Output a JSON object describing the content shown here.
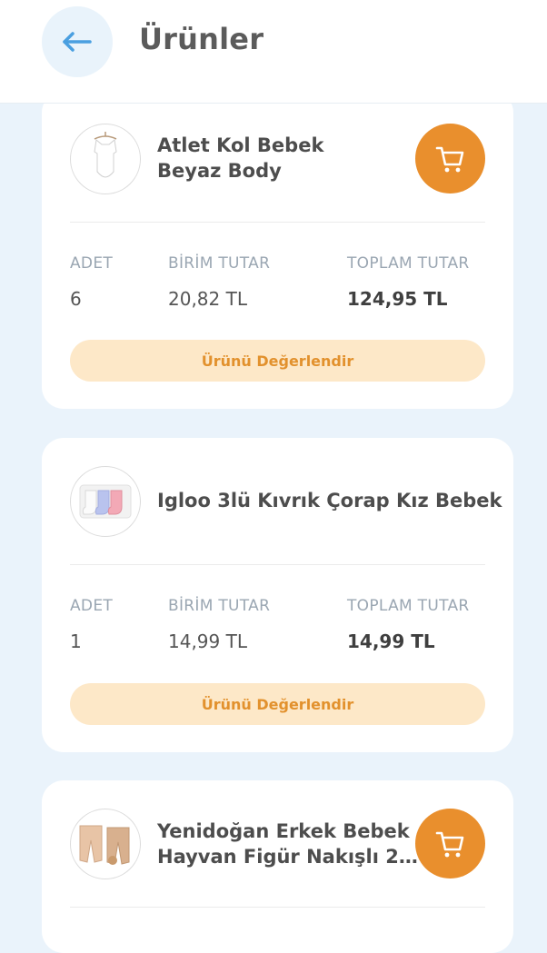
{
  "header": {
    "title": "Ürünler"
  },
  "products": [
    {
      "name_line1": "Atlet Kol Bebek",
      "name_line2": "Beyaz Body",
      "qty_label": "ADET",
      "qty": "6",
      "unit_label": "BİRİM TUTAR",
      "unit_price": "20,82 TL",
      "total_label": "TOPLAM TUTAR",
      "total": "124,95 TL",
      "rate_label": "Ürünü Değerlendir"
    },
    {
      "name_line1": "Igloo 3lü Kıvrık Çorap Kız Bebek",
      "qty_label": "ADET",
      "qty": "1",
      "unit_label": "BİRİM TUTAR",
      "unit_price": "14,99 TL",
      "total_label": "TOPLAM TUTAR",
      "total": "14,99 TL",
      "rate_label": "Ürünü Değerlendir"
    },
    {
      "name_line1": "Yenidoğan Erkek Bebek",
      "name_line2": "Hayvan Figür Nakışlı 2…"
    }
  ],
  "colors": {
    "accent": "#e98f2d",
    "rate_bg": "#fde8c8",
    "page_bg": "#eaf3fb"
  },
  "icons": {
    "back": "arrow-left-icon",
    "cart": "shopping-cart-icon"
  }
}
